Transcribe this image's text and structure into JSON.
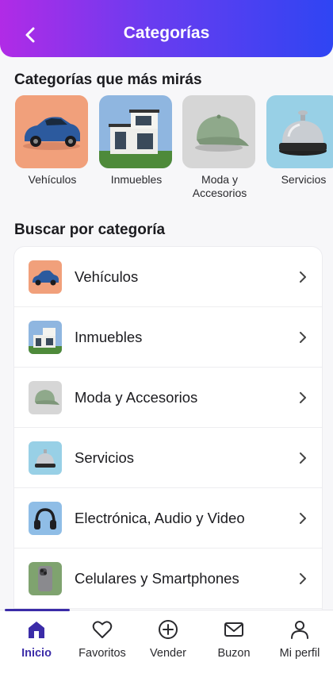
{
  "header": {
    "title": "Categorías",
    "back_icon": "chevron-left-icon"
  },
  "favorites": {
    "title": "Categorías que más mirás",
    "items": [
      {
        "label": "Vehículos",
        "icon": "car-image"
      },
      {
        "label": "Inmuebles",
        "icon": "house-image"
      },
      {
        "label": "Moda y Accesorios",
        "icon": "cap-image"
      },
      {
        "label": "Servicios",
        "icon": "bell-image"
      }
    ]
  },
  "browse": {
    "title": "Buscar por categoría",
    "items": [
      {
        "label": "Vehículos",
        "icon": "car-image"
      },
      {
        "label": "Inmuebles",
        "icon": "house-image"
      },
      {
        "label": "Moda y Accesorios",
        "icon": "cap-image"
      },
      {
        "label": "Servicios",
        "icon": "bell-image"
      },
      {
        "label": "Electrónica, Audio y Video",
        "icon": "headphones-image"
      },
      {
        "label": "Celulares y Smartphones",
        "icon": "phone-image"
      }
    ]
  },
  "bottom_nav": {
    "items": [
      {
        "label": "Inicio",
        "icon": "home-icon",
        "active": true
      },
      {
        "label": "Favoritos",
        "icon": "heart-icon"
      },
      {
        "label": "Vender",
        "icon": "plus-circle-icon"
      },
      {
        "label": "Buzon",
        "icon": "mail-icon"
      },
      {
        "label": "Mi perfil",
        "icon": "user-icon"
      }
    ]
  },
  "colors": {
    "accent": "#3b2ca8",
    "gradient_start": "#b12be6",
    "gradient_end": "#2f45f3"
  }
}
